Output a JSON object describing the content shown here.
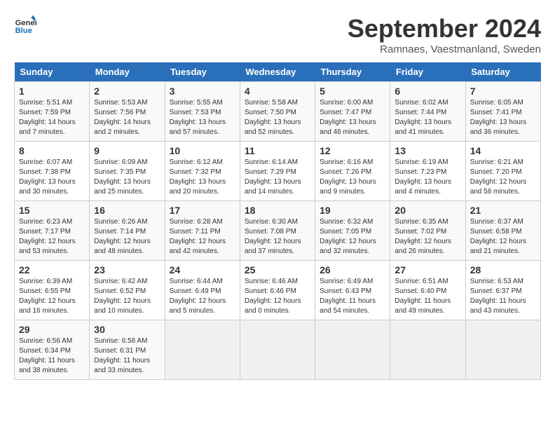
{
  "logo": {
    "text_general": "General",
    "text_blue": "Blue"
  },
  "title": "September 2024",
  "subtitle": "Ramnaes, Vaestmanland, Sweden",
  "headers": [
    "Sunday",
    "Monday",
    "Tuesday",
    "Wednesday",
    "Thursday",
    "Friday",
    "Saturday"
  ],
  "weeks": [
    [
      {
        "day": "1",
        "sunrise": "Sunrise: 5:51 AM",
        "sunset": "Sunset: 7:59 PM",
        "daylight": "Daylight: 14 hours and 7 minutes."
      },
      {
        "day": "2",
        "sunrise": "Sunrise: 5:53 AM",
        "sunset": "Sunset: 7:56 PM",
        "daylight": "Daylight: 14 hours and 2 minutes."
      },
      {
        "day": "3",
        "sunrise": "Sunrise: 5:55 AM",
        "sunset": "Sunset: 7:53 PM",
        "daylight": "Daylight: 13 hours and 57 minutes."
      },
      {
        "day": "4",
        "sunrise": "Sunrise: 5:58 AM",
        "sunset": "Sunset: 7:50 PM",
        "daylight": "Daylight: 13 hours and 52 minutes."
      },
      {
        "day": "5",
        "sunrise": "Sunrise: 6:00 AM",
        "sunset": "Sunset: 7:47 PM",
        "daylight": "Daylight: 13 hours and 46 minutes."
      },
      {
        "day": "6",
        "sunrise": "Sunrise: 6:02 AM",
        "sunset": "Sunset: 7:44 PM",
        "daylight": "Daylight: 13 hours and 41 minutes."
      },
      {
        "day": "7",
        "sunrise": "Sunrise: 6:05 AM",
        "sunset": "Sunset: 7:41 PM",
        "daylight": "Daylight: 13 hours and 36 minutes."
      }
    ],
    [
      {
        "day": "8",
        "sunrise": "Sunrise: 6:07 AM",
        "sunset": "Sunset: 7:38 PM",
        "daylight": "Daylight: 13 hours and 30 minutes."
      },
      {
        "day": "9",
        "sunrise": "Sunrise: 6:09 AM",
        "sunset": "Sunset: 7:35 PM",
        "daylight": "Daylight: 13 hours and 25 minutes."
      },
      {
        "day": "10",
        "sunrise": "Sunrise: 6:12 AM",
        "sunset": "Sunset: 7:32 PM",
        "daylight": "Daylight: 13 hours and 20 minutes."
      },
      {
        "day": "11",
        "sunrise": "Sunrise: 6:14 AM",
        "sunset": "Sunset: 7:29 PM",
        "daylight": "Daylight: 13 hours and 14 minutes."
      },
      {
        "day": "12",
        "sunrise": "Sunrise: 6:16 AM",
        "sunset": "Sunset: 7:26 PM",
        "daylight": "Daylight: 13 hours and 9 minutes."
      },
      {
        "day": "13",
        "sunrise": "Sunrise: 6:19 AM",
        "sunset": "Sunset: 7:23 PM",
        "daylight": "Daylight: 13 hours and 4 minutes."
      },
      {
        "day": "14",
        "sunrise": "Sunrise: 6:21 AM",
        "sunset": "Sunset: 7:20 PM",
        "daylight": "Daylight: 12 hours and 58 minutes."
      }
    ],
    [
      {
        "day": "15",
        "sunrise": "Sunrise: 6:23 AM",
        "sunset": "Sunset: 7:17 PM",
        "daylight": "Daylight: 12 hours and 53 minutes."
      },
      {
        "day": "16",
        "sunrise": "Sunrise: 6:26 AM",
        "sunset": "Sunset: 7:14 PM",
        "daylight": "Daylight: 12 hours and 48 minutes."
      },
      {
        "day": "17",
        "sunrise": "Sunrise: 6:28 AM",
        "sunset": "Sunset: 7:11 PM",
        "daylight": "Daylight: 12 hours and 42 minutes."
      },
      {
        "day": "18",
        "sunrise": "Sunrise: 6:30 AM",
        "sunset": "Sunset: 7:08 PM",
        "daylight": "Daylight: 12 hours and 37 minutes."
      },
      {
        "day": "19",
        "sunrise": "Sunrise: 6:32 AM",
        "sunset": "Sunset: 7:05 PM",
        "daylight": "Daylight: 12 hours and 32 minutes."
      },
      {
        "day": "20",
        "sunrise": "Sunrise: 6:35 AM",
        "sunset": "Sunset: 7:02 PM",
        "daylight": "Daylight: 12 hours and 26 minutes."
      },
      {
        "day": "21",
        "sunrise": "Sunrise: 6:37 AM",
        "sunset": "Sunset: 6:58 PM",
        "daylight": "Daylight: 12 hours and 21 minutes."
      }
    ],
    [
      {
        "day": "22",
        "sunrise": "Sunrise: 6:39 AM",
        "sunset": "Sunset: 6:55 PM",
        "daylight": "Daylight: 12 hours and 16 minutes."
      },
      {
        "day": "23",
        "sunrise": "Sunrise: 6:42 AM",
        "sunset": "Sunset: 6:52 PM",
        "daylight": "Daylight: 12 hours and 10 minutes."
      },
      {
        "day": "24",
        "sunrise": "Sunrise: 6:44 AM",
        "sunset": "Sunset: 6:49 PM",
        "daylight": "Daylight: 12 hours and 5 minutes."
      },
      {
        "day": "25",
        "sunrise": "Sunrise: 6:46 AM",
        "sunset": "Sunset: 6:46 PM",
        "daylight": "Daylight: 12 hours and 0 minutes."
      },
      {
        "day": "26",
        "sunrise": "Sunrise: 6:49 AM",
        "sunset": "Sunset: 6:43 PM",
        "daylight": "Daylight: 11 hours and 54 minutes."
      },
      {
        "day": "27",
        "sunrise": "Sunrise: 6:51 AM",
        "sunset": "Sunset: 6:40 PM",
        "daylight": "Daylight: 11 hours and 49 minutes."
      },
      {
        "day": "28",
        "sunrise": "Sunrise: 6:53 AM",
        "sunset": "Sunset: 6:37 PM",
        "daylight": "Daylight: 11 hours and 43 minutes."
      }
    ],
    [
      {
        "day": "29",
        "sunrise": "Sunrise: 6:56 AM",
        "sunset": "Sunset: 6:34 PM",
        "daylight": "Daylight: 11 hours and 38 minutes."
      },
      {
        "day": "30",
        "sunrise": "Sunrise: 6:58 AM",
        "sunset": "Sunset: 6:31 PM",
        "daylight": "Daylight: 11 hours and 33 minutes."
      },
      null,
      null,
      null,
      null,
      null
    ]
  ]
}
